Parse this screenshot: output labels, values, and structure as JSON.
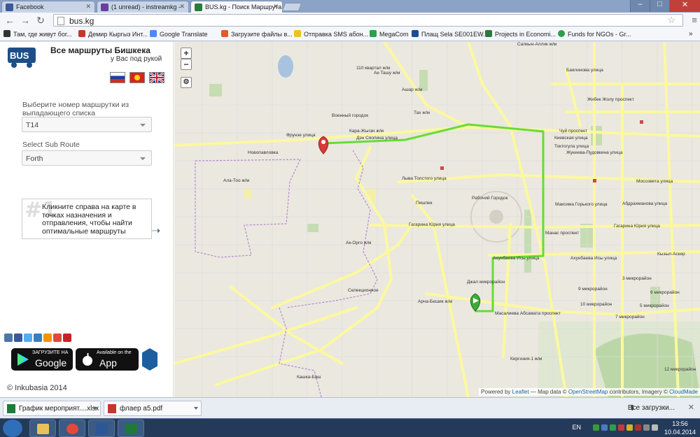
{
  "browser": {
    "tabs": [
      {
        "label": "Facebook",
        "color": "#3b5998"
      },
      {
        "label": "(1 unread) - instreamkg - ",
        "color": "#6b3fa0"
      },
      {
        "label": "BUS.kg - Поиск Маршрута",
        "color": "#2a7a3a"
      }
    ],
    "url": "bus.kg",
    "bookmarks": [
      {
        "label": "Там, где живут бог...",
        "color": "#333333"
      },
      {
        "label": "Демир Кыргыз Инт...",
        "color": "#c0392b"
      },
      {
        "label": "Google Translate",
        "color": "#4a8af4"
      },
      {
        "label": "Загрузите файлы в...",
        "color": "#e05a2b"
      },
      {
        "label": "Отправка SMS абон...",
        "color": "#f0c020"
      },
      {
        "label": "MegaCom",
        "color": "#2e9e4a"
      },
      {
        "label": "Плащ Sela SE001EW...",
        "color": "#1b4c8f"
      },
      {
        "label": "Projects in Economi...",
        "color": "#2a7a3a"
      },
      {
        "label": "Funds for NGOs - Gr...",
        "color": "#2e9e4a"
      }
    ]
  },
  "sidebar": {
    "title": "Все маршруты Бишкека",
    "subtitle": "у Вас под рукой",
    "route_label": "Выберите номер маршрутки из выпадающего списка",
    "route_value": "T14",
    "subroute_label": "Select Sub Route",
    "subroute_value": "Forth",
    "hint_number": "#1",
    "hint_text": "Кликните справа на карте в точках назначения и отправления, чтобы найти оптимальные маршруты",
    "google_play_small": "ЗАГРУЗИТЕ НА",
    "google_play": "Google play",
    "app_store_small": "Available on the",
    "app_store": "App Store",
    "copyright": "© Inkubasia 2014"
  },
  "map": {
    "zoom_in": "+",
    "zoom_out": "−",
    "attribution_prefix": "Powered by",
    "attribution_leaflet": "Leaflet",
    "attribution_mid": " — Map data ©",
    "attribution_osm": "OpenStreetMap",
    "attribution_mid2": " contributors, Imagery ©",
    "attribution_cm": "CloudMade",
    "route_color": "#66dd33",
    "road_color": "#f5e97a",
    "labels": {
      "l1": "Фрунзе улица",
      "l2": "Дэн Сяопина улица",
      "l3": "Новопавловка",
      "l4": "Ала-Тоо ж/м",
      "l5": "Военный городок",
      "l6": "Кара-Жыгач ж/м",
      "l7": "Лыва Толстого улица",
      "l8": "Пишпек",
      "l9": "Гагарина Юрия улица",
      "l10": "Рабочий Городок",
      "l11": "Ак-Орго ж/м",
      "l12": "Селекционное",
      "l13": "Арча-Бешик ж/м",
      "l14": "Джал микрорайон",
      "l15": "Масалиева Абсамата проспект",
      "l16": "Чуй проспект",
      "l17": "Токтогула улица",
      "l18": "Киевская улица",
      "l19": "Максима Горького улица",
      "l20": "Ахунбаева Исы улица",
      "l21": "9 микрорайон",
      "l22": "10 микрорайон",
      "l23": "3 микрорайон",
      "l24": "5 микрорайон",
      "l25": "7 микрорайон",
      "l26": "12 микрорайон",
      "l27": "Киргизия-1 ж/м",
      "l28": "Кашка-Баш",
      "l29": "Жибек Жолу проспект",
      "l30": "Баялинова улица",
      "l31": "Салкын-Аллик ж/м",
      "l32": "110 квартал ж/м",
      "l33": "Ак-Ташу ж/м",
      "l34": "Ашар ж/м",
      "l35": "Тах ж/м",
      "l36": "Гагарина Юрия улица",
      "l37": "Жукеева-Пудовкина улица",
      "l38": "Моссовета улица",
      "l39": "Ахунбаева Исы улица",
      "l40": "Кызыл-Аскер",
      "l41": "6 микрорайон",
      "l42": "Манас проспект",
      "l43": "Абдрахманова улица"
    }
  },
  "downloads": {
    "items": [
      "График мероприят....xlsx",
      "флаер а5.pdf"
    ],
    "show_all": "Все загрузки..."
  },
  "taskbar": {
    "lang": "EN",
    "time": "13:56",
    "date": "10.04.2014"
  }
}
